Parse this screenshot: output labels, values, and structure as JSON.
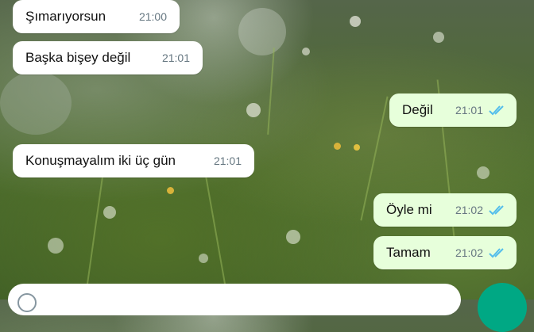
{
  "messages": [
    {
      "direction": "incoming",
      "text": "Şımarıyorsun",
      "time": "21:00"
    },
    {
      "direction": "incoming",
      "text": "Başka bişey değil",
      "time": "21:01"
    },
    {
      "direction": "outgoing",
      "text": "Değil",
      "time": "21:01",
      "status": "read"
    },
    {
      "direction": "incoming",
      "text": "Konuşmayalım iki üç gün",
      "time": "21:01"
    },
    {
      "direction": "outgoing",
      "text": "Öyle mi",
      "time": "21:02",
      "status": "read"
    },
    {
      "direction": "outgoing",
      "text": "Tamam",
      "time": "21:02",
      "status": "read"
    }
  ],
  "colors": {
    "incoming_bubble": "#ffffff",
    "outgoing_bubble": "#e7ffdb",
    "read_ticks": "#53bdeb",
    "send_button": "#00a884"
  },
  "icons": {
    "read_receipt": "double-check-icon",
    "emoji": "emoji-icon"
  }
}
